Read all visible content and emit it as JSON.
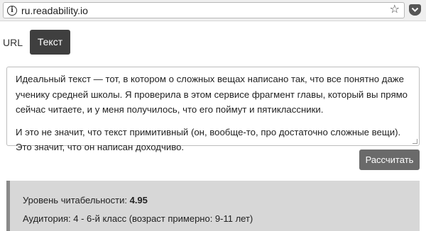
{
  "browser": {
    "url": "ru.readability.io",
    "info_icon": "info-icon",
    "star_icon": "star-icon",
    "pocket_icon": "pocket-icon"
  },
  "mode": {
    "url_label": "URL",
    "text_tab_label": "Текст"
  },
  "text_input": {
    "paragraphs": [
      "Идеальный текст — тот, в котором о сложных вещах написано так, что все понятно даже ученику средней школы. Я проверила в этом сервисе фрагмент главы, который вы прямо сейчас читаете, и у меня получилось, что его поймут и пятиклассники.",
      "И это не значит, что текст примитивный (он, вообще-то, про достаточно сложные вещи). Это значит, что он написан доходчиво."
    ]
  },
  "calculate_label": "Рассчитать",
  "result": {
    "readability_label": "Уровень читабельности:",
    "readability_value": "4.95",
    "audience": "Аудитория: 4 - 6-й класс (возраст примерно: 9-11 лет)"
  }
}
